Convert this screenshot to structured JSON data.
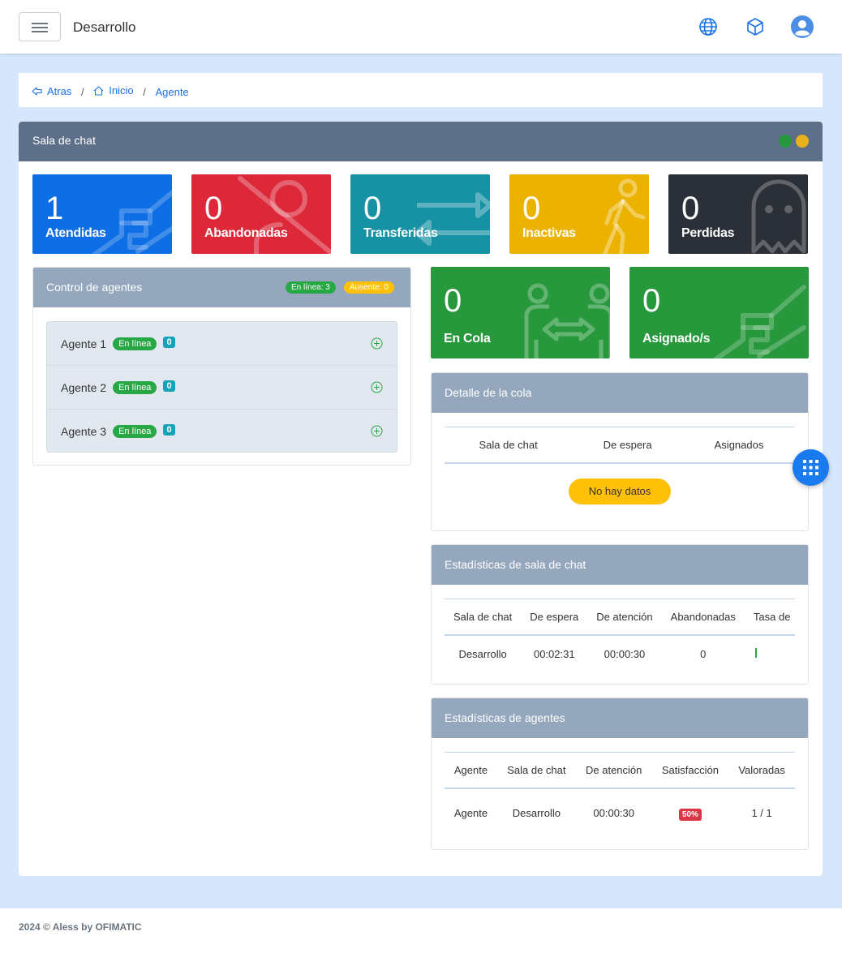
{
  "header": {
    "title": "Desarrollo",
    "icons": [
      "menu-icon",
      "globe-icon",
      "cube-icon",
      "user-icon"
    ]
  },
  "breadcrumb": {
    "back": "Atras",
    "home": "Inicio",
    "current": "Agente",
    "sep": "/"
  },
  "main": {
    "title": "Sala de chat"
  },
  "stats": [
    {
      "value": "1",
      "label": "Atendidas",
      "color": "#0d6ee5",
      "icon": "handshake-icon"
    },
    {
      "value": "0",
      "label": "Abandonadas",
      "color": "#dc2839",
      "icon": "user-slash-icon"
    },
    {
      "value": "0",
      "label": "Transferidas",
      "color": "#1791a4",
      "icon": "exchange-icon"
    },
    {
      "value": "0",
      "label": "Inactivas",
      "color": "#ecb200",
      "icon": "walking-icon"
    },
    {
      "value": "0",
      "label": "Perdidas",
      "color": "#2b3038",
      "icon": "ghost-icon"
    }
  ],
  "queue_stats": [
    {
      "value": "0",
      "label": "En Cola",
      "color": "#28983d",
      "icon": "people-arrows-icon"
    },
    {
      "value": "0",
      "label": "Asignado/s",
      "color": "#28983d",
      "icon": "handshake-icon"
    }
  ],
  "agents_panel": {
    "title": "Control de agentes",
    "online_badge": "En línea: 3",
    "away_badge": "Ausente: 0",
    "agents": [
      {
        "name": "Agente 1",
        "status": "En línea",
        "count": "0"
      },
      {
        "name": "Agente 2",
        "status": "En línea",
        "count": "0"
      },
      {
        "name": "Agente 3",
        "status": "En línea",
        "count": "0"
      }
    ]
  },
  "queue_detail": {
    "title": "Detalle de la cola",
    "columns": [
      "Sala de chat",
      "De espera",
      "Asignados"
    ],
    "empty": "No hay datos"
  },
  "room_stats": {
    "title": "Estadísticas de sala de chat",
    "columns": [
      "Sala de chat",
      "De espera",
      "De atención",
      "Abandonadas",
      "Tasa de"
    ],
    "rows": [
      [
        "Desarrollo",
        "00:02:31",
        "00:00:30",
        "0",
        ""
      ]
    ]
  },
  "agent_stats": {
    "title": "Estadísticas de agentes",
    "columns": [
      "Agente",
      "Sala de chat",
      "De atención",
      "Satisfacción",
      "Valoradas"
    ],
    "rows": [
      [
        "Agente",
        "Desarrollo",
        "00:00:30",
        "50%",
        "1 / 1"
      ]
    ]
  },
  "footer": {
    "text": "2024 © Aless by OFIMATIC"
  },
  "colors": {
    "accent": "#1a73e8",
    "online": "#28a745",
    "away": "#ffc107",
    "header": "#5e7089",
    "panel_head": "#94a7bd"
  }
}
